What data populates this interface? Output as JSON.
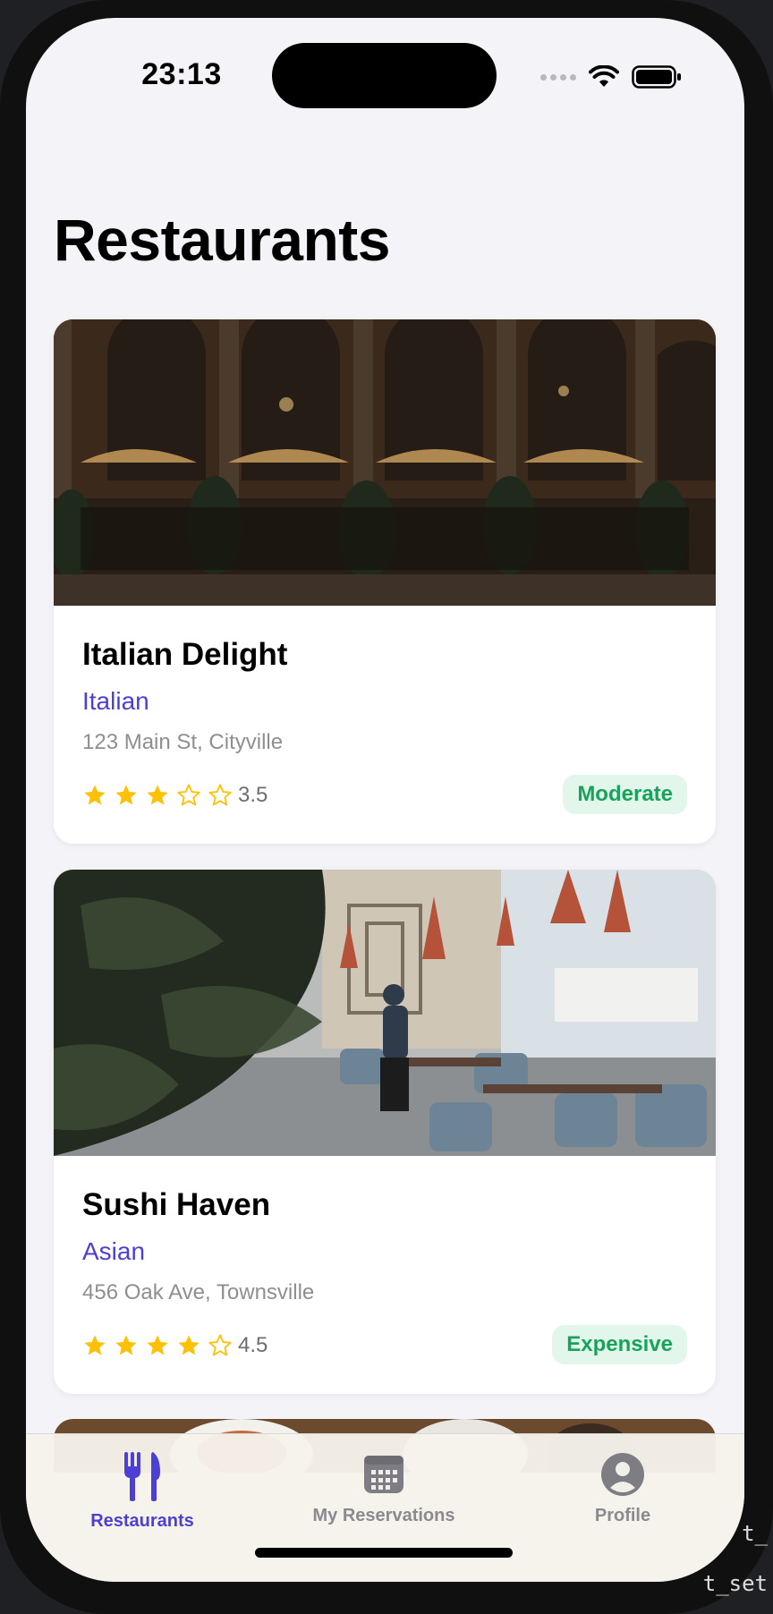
{
  "status_bar": {
    "time": "23:13"
  },
  "page": {
    "title": "Restaurants"
  },
  "restaurants": [
    {
      "name": "Italian Delight",
      "cuisine": "Italian",
      "address": "123 Main St, Cityville",
      "rating": 3.5,
      "rating_label": "3.5",
      "stars": [
        "full",
        "full",
        "full",
        "empty",
        "empty"
      ],
      "price": "Moderate"
    },
    {
      "name": "Sushi Haven",
      "cuisine": "Asian",
      "address": "456 Oak Ave, Townsville",
      "rating": 4.5,
      "rating_label": "4.5",
      "stars": [
        "full",
        "full",
        "full",
        "full",
        "empty"
      ],
      "price": "Expensive"
    }
  ],
  "tabs": [
    {
      "label": "Restaurants",
      "icon": "fork-knife-icon",
      "selected": true
    },
    {
      "label": "My Reservations",
      "icon": "calendar-icon",
      "selected": false
    },
    {
      "label": "Profile",
      "icon": "person-circle-icon",
      "selected": false
    }
  ],
  "background_text": {
    "line1": "t_",
    "line2": "t_set"
  },
  "colors": {
    "accent": "#4b3fd6",
    "price_text": "#18a35b",
    "price_bg": "#e3f6ec",
    "star": "#ffc107",
    "muted": "#8e8e93"
  }
}
